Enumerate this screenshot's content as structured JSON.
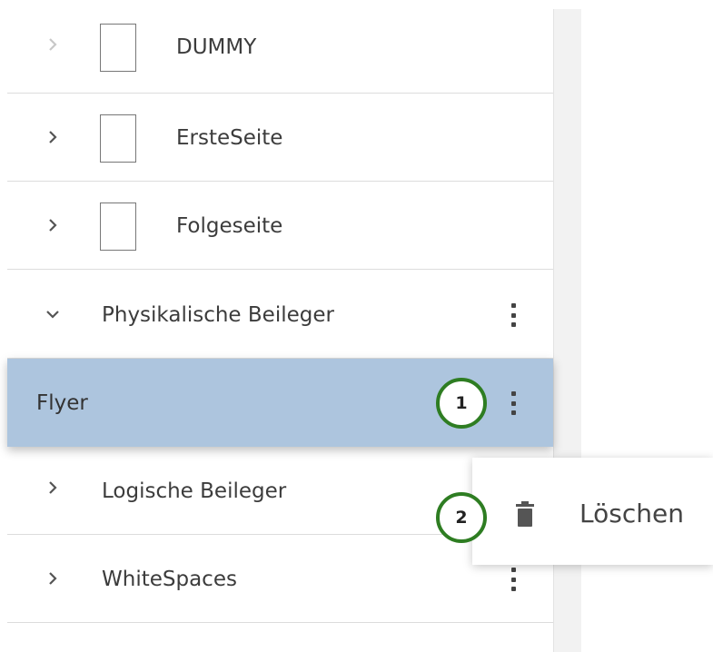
{
  "tree": {
    "items": [
      {
        "label": "DUMMY",
        "has_page_icon": true,
        "expanded": false,
        "chevron": "chevron-right-icon"
      },
      {
        "label": "ErsteSeite",
        "has_page_icon": true,
        "expanded": false,
        "chevron": "chevron-right-icon"
      },
      {
        "label": "Folgeseite",
        "has_page_icon": true,
        "expanded": false,
        "chevron": "chevron-right-icon"
      },
      {
        "label": "Physikalische Beileger",
        "expanded": true,
        "chevron": "chevron-down-icon",
        "menu_icon": "more-vertical-icon"
      },
      {
        "label": "Flyer",
        "selected": true,
        "menu_icon": "more-vertical-icon"
      },
      {
        "label": "Logische Beileger",
        "expanded": false,
        "chevron": "chevron-right-icon"
      },
      {
        "label": "WhiteSpaces",
        "expanded": false,
        "chevron": "chevron-right-icon",
        "menu_icon": "more-vertical-icon"
      }
    ]
  },
  "context_menu": {
    "items": [
      {
        "label": "Löschen",
        "icon": "trash-icon"
      }
    ]
  },
  "annotations": {
    "step1": "1",
    "step2": "2",
    "color": "#2e7d22"
  },
  "colors": {
    "selected_row": "#adc5de",
    "text": "#3c3c3c"
  }
}
